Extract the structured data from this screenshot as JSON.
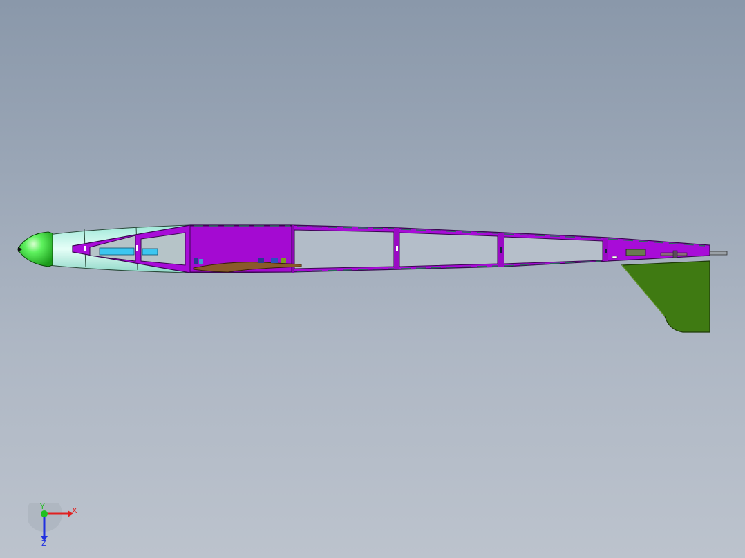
{
  "viewport": {
    "background_top": "#8a98aa",
    "background_bottom": "#bcc3cd"
  },
  "model": {
    "colors": {
      "nose_cone": "#2fe02f",
      "canopy": "#bff0e6",
      "frame": "#a80cd8",
      "fin": "#3f7a12",
      "component_blue": "#3cc6f0",
      "wood": "#8a5a2a"
    }
  },
  "triad": {
    "x_label": "X",
    "y_label": "Y",
    "z_label": "Z",
    "x_color": "#e02020",
    "y_color": "#20c020",
    "z_color": "#2030e0"
  }
}
